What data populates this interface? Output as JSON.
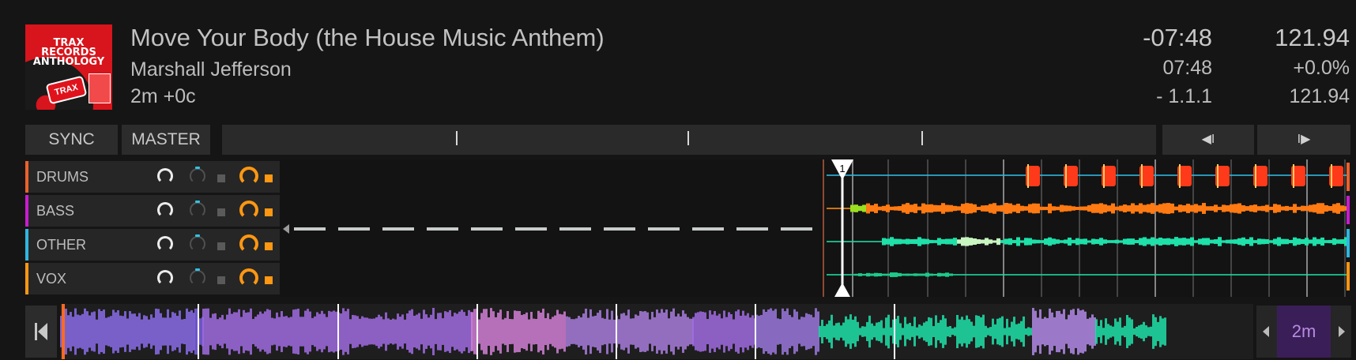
{
  "track": {
    "title": "Move Your Body (the House Music Anthem)",
    "artist": "Marshall Jefferson",
    "key_info": "2m +0c",
    "cover": {
      "title": "TRAX RECORDS ANTHOLOGY",
      "logo": "TRAX"
    }
  },
  "display": {
    "remaining": "-07:48",
    "tempo": "121.94",
    "elapsed": "07:48",
    "pitch": "+0.0%",
    "beat_position": "-  1.1.1",
    "bpm": "121.94"
  },
  "controls": {
    "sync_label": "SYNC",
    "master_label": "MASTER",
    "jump_back_label": "◀I",
    "jump_forward_label": "I▶"
  },
  "stems": [
    {
      "name": "DRUMS",
      "color": "#e8622c"
    },
    {
      "name": "BASS",
      "color": "#c81ccf"
    },
    {
      "name": "OTHER",
      "color": "#2fb7e0"
    },
    {
      "name": "VOX",
      "color": "#ff9712"
    }
  ],
  "cue_marker": "1",
  "zoom": {
    "value": "2m"
  },
  "colors": {
    "accent_orange": "#ff9712",
    "playhead": "#ffffff",
    "overview_purple": "#a06be0",
    "zoom_bg": "#3a1e58"
  },
  "icons": [
    "jump-back-icon",
    "jump-forward-icon",
    "skip-to-start-icon",
    "zoom-in-icon",
    "zoom-out-icon",
    "cue-marker-icon"
  ]
}
